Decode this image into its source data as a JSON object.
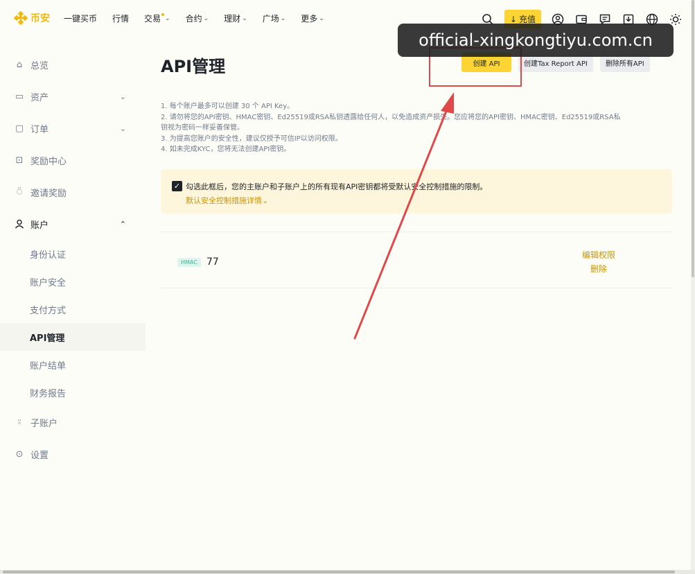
{
  "brand": {
    "name": "币安"
  },
  "nav": {
    "items": [
      {
        "label": "一键买币",
        "chevron": false
      },
      {
        "label": "行情",
        "chevron": false
      },
      {
        "label": "交易",
        "chevron": true
      },
      {
        "label": "合约",
        "chevron": true
      },
      {
        "label": "理财",
        "chevron": true
      },
      {
        "label": "广场",
        "chevron": true
      },
      {
        "label": "更多",
        "chevron": true
      }
    ],
    "deposit_label": "充值",
    "right_icons": [
      "search-icon",
      "user-icon",
      "wallet-icon",
      "message-icon",
      "download-icon",
      "globe-icon",
      "sun-icon"
    ]
  },
  "watermark": "official-xingkongtiyu.com.cn",
  "sidebar": {
    "items": [
      {
        "label": "总览",
        "icon": "home-icon"
      },
      {
        "label": "资产",
        "icon": "wallet-icon",
        "chevron": "⌄"
      },
      {
        "label": "订单",
        "icon": "order-icon",
        "chevron": "⌄"
      },
      {
        "label": "奖励中心",
        "icon": "reward-icon"
      },
      {
        "label": "邀请奖励",
        "icon": "invite-icon"
      },
      {
        "label": "账户",
        "icon": "account-icon",
        "chevron": "⌃"
      }
    ],
    "account_sub": [
      "身份认证",
      "账户安全",
      "支付方式",
      "API管理",
      "账户结单",
      "财务报告"
    ],
    "bottom_items": [
      {
        "label": "子账户",
        "icon": "subaccount-icon"
      },
      {
        "label": "设置",
        "icon": "settings-icon"
      }
    ]
  },
  "main": {
    "title": "API管理",
    "buttons": {
      "create_api": "创建 API",
      "create_tax": "创建Tax Report API",
      "delete_all": "删除所有API"
    },
    "notes": [
      "1. 每个账户最多可以创建 30 个 API Key。",
      "2. 请勿将您的API密钥、HMAC密钥、Ed25519或RSA私钥透露给任何人，以免造成资产损失。您应将您的API密钥、HMAC密钥、Ed25519或RSA私",
      "钥视为密码一样妥善保管。",
      "3. 为提高您账户的安全性，建议仅授予可信IP以访问权限。",
      "4. 如未完成KYC，您将无法创建API密钥。"
    ],
    "warning": {
      "text": "勾选此框后，您的主账户和子账户上的所有现有API密钥都将受默认安全控制措施的限制。",
      "link": "默认安全控制措施详情⌄"
    },
    "api_entry": {
      "badge": "HMAC",
      "name": "77",
      "edit_label": "编辑权限",
      "delete_label": "删除"
    }
  },
  "colors": {
    "brand": "#f0b90b",
    "accent": "#fcd535",
    "annotation": "#e0484a",
    "link": "#c99400"
  }
}
